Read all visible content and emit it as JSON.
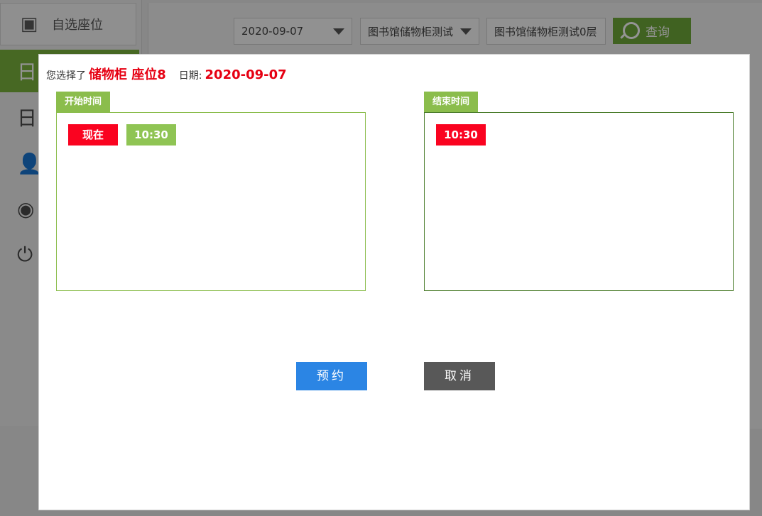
{
  "background": {
    "sidebar": {
      "self_select_label": "自选座位",
      "items": [
        {
          "glyph": "日"
        },
        {
          "glyph": "日"
        },
        {
          "glyph": "👤"
        },
        {
          "glyph": "◉"
        },
        {
          "glyph": "⏻"
        }
      ]
    },
    "filters": {
      "date_value": "2020-09-07",
      "library_value": "图书馆储物柜测试",
      "floor_value": "图书馆储物柜测试0层",
      "query_label": "查询"
    }
  },
  "modal": {
    "selection_prefix": "您选择了",
    "selection_item": "储物柜 座位8",
    "date_prefix": "日期:",
    "date_value": "2020-09-07",
    "start_panel": {
      "title": "开始时间",
      "options": [
        "现在",
        "10:30"
      ]
    },
    "end_panel": {
      "title": "结束时间",
      "options": [
        "10:30"
      ]
    },
    "reserve_label": "预约",
    "cancel_label": "取消"
  },
  "colors": {
    "accent_green": "#8bbd4c",
    "dark_green": "#4b7d2c",
    "highlight_red": "#e60012",
    "selected_red": "#fa0320",
    "primary_blue": "#2b85e4",
    "cancel_gray": "#585858"
  }
}
